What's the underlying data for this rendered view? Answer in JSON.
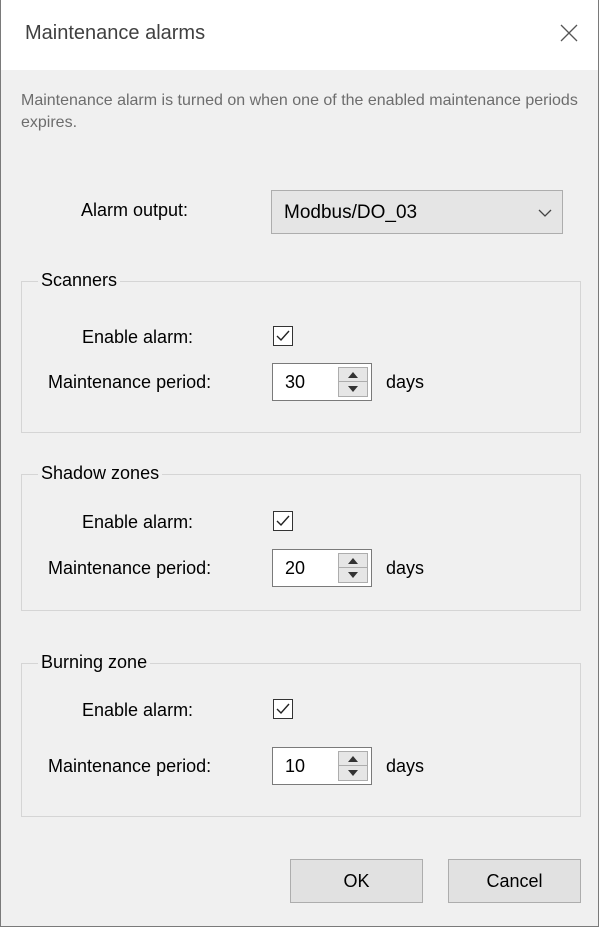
{
  "dialog": {
    "title": "Maintenance alarms",
    "description": "Maintenance alarm is turned on when one of the enabled maintenance periods expires."
  },
  "alarm_output": {
    "label": "Alarm output:",
    "value": "Modbus/DO_03"
  },
  "groups": [
    {
      "title": "Scanners",
      "enable_label": "Enable alarm:",
      "enabled": true,
      "period_label": "Maintenance period:",
      "period_value": "30",
      "unit": "days"
    },
    {
      "title": "Shadow zones",
      "enable_label": "Enable alarm:",
      "enabled": true,
      "period_label": "Maintenance period:",
      "period_value": "20",
      "unit": "days"
    },
    {
      "title": "Burning zone",
      "enable_label": "Enable alarm:",
      "enabled": true,
      "period_label": "Maintenance period:",
      "period_value": "10",
      "unit": "days"
    }
  ],
  "buttons": {
    "ok": "OK",
    "cancel": "Cancel"
  },
  "icons": {
    "close": "close-icon",
    "dropdown": "chevron-down-icon",
    "check": "checkmark-icon",
    "spin_up": "triangle-up-icon",
    "spin_down": "triangle-down-icon"
  }
}
